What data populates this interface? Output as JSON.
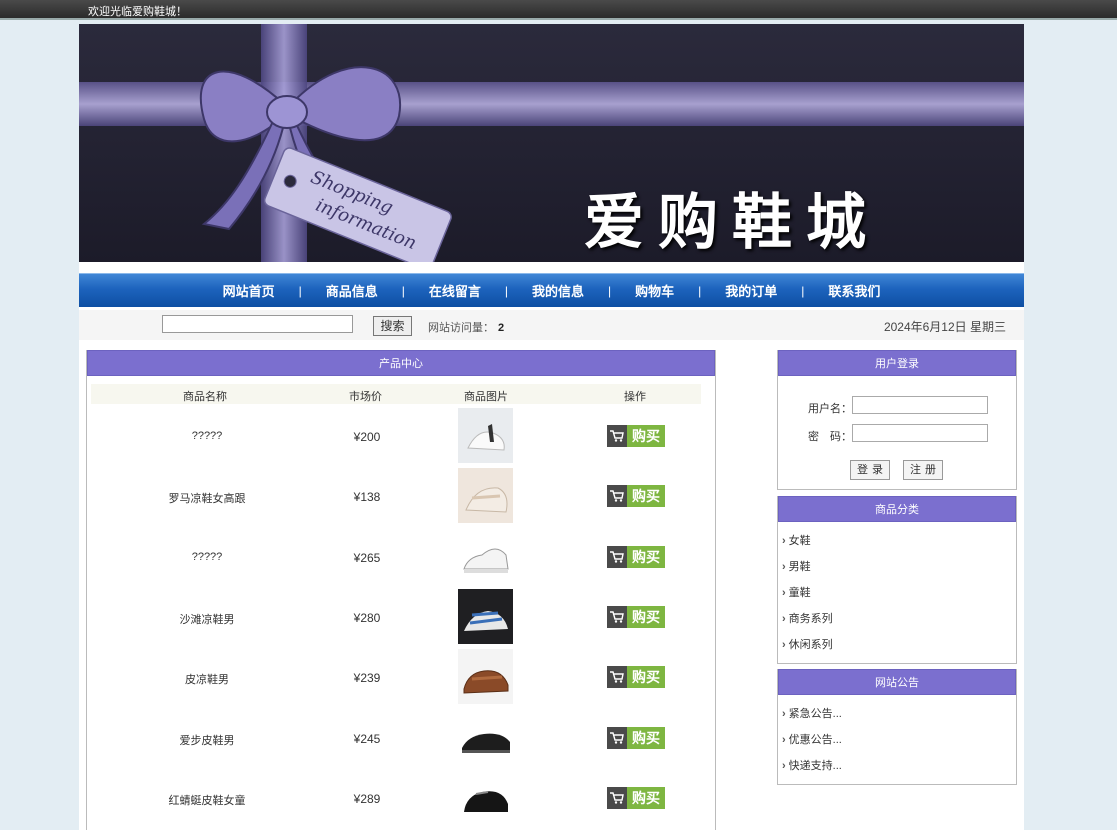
{
  "topbar": {
    "welcome": "欢迎光临爱购鞋城！"
  },
  "banner": {
    "title": "爱购鞋城",
    "tag_line1": "Shopping",
    "tag_line2": "information"
  },
  "nav": {
    "items": [
      "网站首页",
      "商品信息",
      "在线留言",
      "我的信息",
      "购物车",
      "我的订单",
      "联系我们"
    ],
    "separator": "|"
  },
  "search": {
    "button": "搜索",
    "value": "",
    "visits_label": "网站访问量：",
    "visits_count": "2",
    "date": "2024年6月12日 星期三"
  },
  "products": {
    "title": "产品中心",
    "columns": {
      "name": "商品名称",
      "price": "市场价",
      "image": "商品图片",
      "action": "操作"
    },
    "buy_label": "购买",
    "rows": [
      {
        "name": "?????",
        "price": "¥200",
        "image": "white-sandal-photo"
      },
      {
        "name": "罗马凉鞋女高跟",
        "price": "¥138",
        "image": "beige-sandal-photo"
      },
      {
        "name": "?????",
        "price": "¥265",
        "image": "white-sneaker-photo"
      },
      {
        "name": "沙滩凉鞋男",
        "price": "¥280",
        "image": "black-sport-sandal-photo"
      },
      {
        "name": "皮凉鞋男",
        "price": "¥239",
        "image": "brown-leather-sandal-photo"
      },
      {
        "name": "爱步皮鞋男",
        "price": "¥245",
        "image": "black-leather-shoe-photo"
      },
      {
        "name": "红蜻蜓皮鞋女童",
        "price": "¥289",
        "image": "black-girls-shoe-photo"
      }
    ]
  },
  "login": {
    "title": "用户登录",
    "username_label": "用户名：",
    "password_label": "密　码：",
    "login_button": "登录",
    "register_button": "注册"
  },
  "categories": {
    "title": "商品分类",
    "items": [
      "女鞋",
      "男鞋",
      "童鞋",
      "商务系列",
      "休闲系列"
    ]
  },
  "notices": {
    "title": "网站公告",
    "items": [
      "紧急公告...",
      "优惠公告...",
      "快递支持..."
    ]
  }
}
